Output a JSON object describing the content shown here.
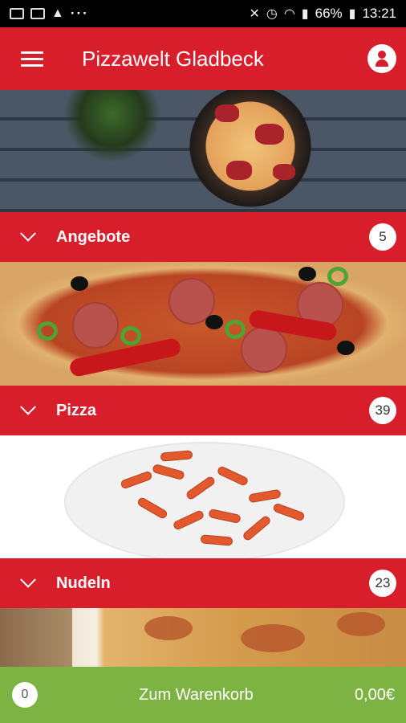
{
  "statusbar": {
    "left_icons": [
      "image-icon",
      "gallery-icon",
      "cloud-icon"
    ],
    "dots": "···",
    "battery": "66%",
    "time": "13:21"
  },
  "appbar": {
    "title": "Pizzawelt Gladbeck"
  },
  "categories": [
    {
      "label": "Angebote",
      "count": "5"
    },
    {
      "label": "Pizza",
      "count": "39"
    },
    {
      "label": "Nudeln",
      "count": "23"
    }
  ],
  "cart": {
    "count": "0",
    "label": "Zum Warenkorb",
    "total": "0,00€"
  },
  "colors": {
    "brand_red": "#d81d2b",
    "cart_green": "#7cb342"
  }
}
